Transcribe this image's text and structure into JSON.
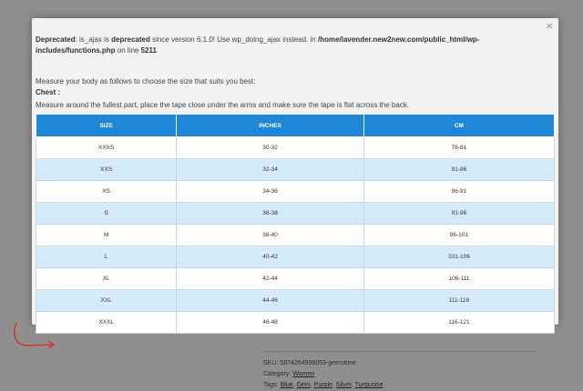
{
  "background": {
    "sku_label": "SKU:",
    "sku_value": "5874264998053-gemstone",
    "category_label": "Category:",
    "category_value": "Women",
    "tags_label": "Tags:",
    "tags": [
      "Blue",
      "Gem",
      "Purple",
      "Silver",
      "Turquoise"
    ]
  },
  "modal": {
    "close_symbol": "×",
    "warning": {
      "deprecated_label": "Deprecated",
      "text1": ": is_ajax is ",
      "deprecated_word": "deprecated",
      "text2": " since version 6.1.0! Use wp_doing_ajax instead. in ",
      "path": "/home/lavender.new2new.com/public_html/wp-includes/functions.php",
      "text3": " on line ",
      "line": "5211"
    },
    "intro": "Measure your body as follows to choose the size that suits you best:",
    "section_title": "Chest :",
    "section_desc": "Measure around the fullest part, place the tape close under the arms and make sure the tape is flat across the back."
  },
  "size_table": {
    "headers": [
      "SIZE",
      "INCHES",
      "CM"
    ],
    "rows": [
      [
        "XXXS",
        "30-32",
        "76-81"
      ],
      [
        "XXS",
        "32-34",
        "81-86"
      ],
      [
        "XS",
        "34-36",
        "86-91"
      ],
      [
        "S",
        "36-38",
        "91-96"
      ],
      [
        "M",
        "38-40",
        "96-101"
      ],
      [
        "L",
        "40-42",
        "101-106"
      ],
      [
        "XL",
        "42-44",
        "106-111"
      ],
      [
        "XXL",
        "44-46",
        "111-116"
      ],
      [
        "XXXL",
        "46-48",
        "116-121"
      ]
    ]
  },
  "colors": {
    "header_blue": "#1e87d6",
    "row_alt": "#d6ebfa",
    "annotation_red": "#e0302a"
  }
}
